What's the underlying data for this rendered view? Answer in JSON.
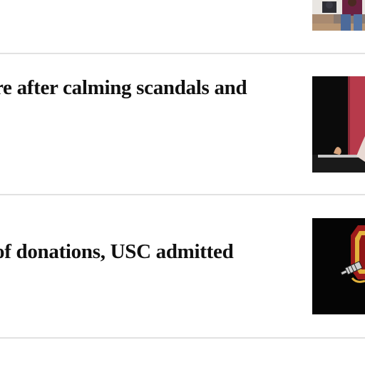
{
  "articles": [
    {
      "headline": "",
      "thumbnail": "people-sitting-photo"
    },
    {
      "headline": "re after calming scandals and",
      "thumbnail": "speaker-at-podium-photo"
    },
    {
      "headline": "of donations, USC admitted",
      "thumbnail": "usc-trojan-logo-photo"
    }
  ]
}
